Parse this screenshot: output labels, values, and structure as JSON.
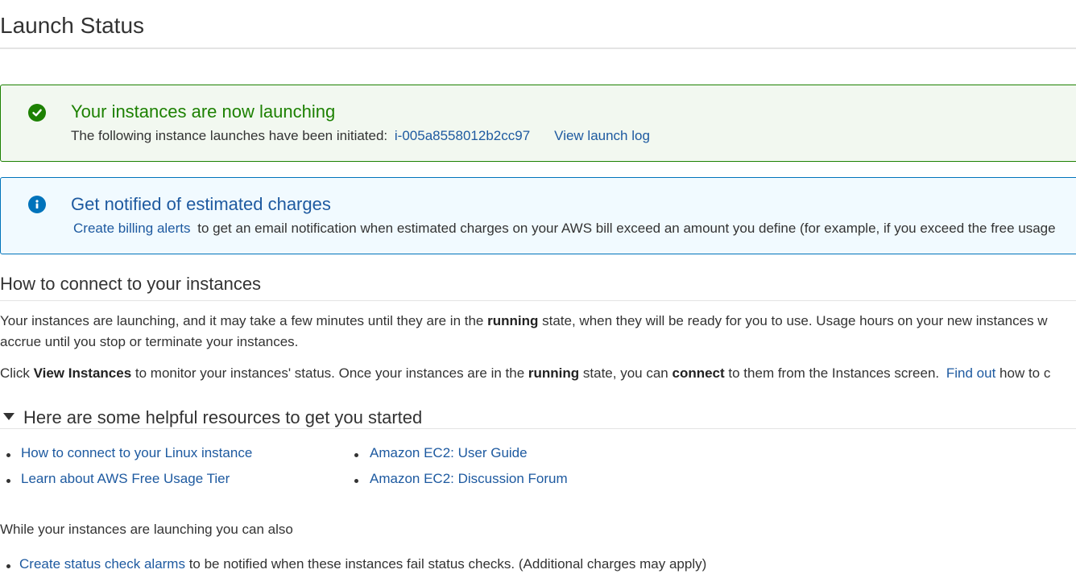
{
  "page": {
    "title": "Launch Status"
  },
  "success_alert": {
    "heading": "Your instances are now launching",
    "body_text": "The following instance launches have been initiated:",
    "instance_id": "i-005a8558012b2cc97",
    "view_log_label": "View launch log",
    "icon": "check-circle-icon",
    "color": "#1d8102"
  },
  "info_alert": {
    "heading": "Get notified of estimated charges",
    "link_label": "Create billing alerts",
    "body_text": "to get an email notification when estimated charges on your AWS bill exceed an amount you define (for example, if you exceed the free usage",
    "icon": "info-circle-icon",
    "color": "#0073bb"
  },
  "connect_section": {
    "heading": "How to connect to your instances",
    "para1_a": "Your instances are launching, and it may take a few minutes until they are in the",
    "para1_bold": "running",
    "para1_b": "state, when they will be ready for you to use. Usage hours on your new instances w",
    "para1_line2": "accrue until you stop or terminate your instances.",
    "para2_a": "Click",
    "para2_bold1": "View Instances",
    "para2_b": "to monitor your instances' status. Once your instances are in the",
    "para2_bold2": "running",
    "para2_c": "state, you can",
    "para2_bold3": "connect",
    "para2_d": "to them from the Instances screen.",
    "find_out_label": "Find out",
    "para2_e": "how to c"
  },
  "resources_section": {
    "heading": "Here are some helpful resources to get you started",
    "left_links": [
      "How to connect to your Linux instance",
      "Learn about AWS Free Usage Tier"
    ],
    "right_links": [
      "Amazon EC2: User Guide",
      "Amazon EC2: Discussion Forum"
    ]
  },
  "also_section": {
    "heading": "While your instances are launching you can also",
    "item_link": "Create status check alarms",
    "item_text": "to be notified when these instances fail status checks. (Additional charges may apply)"
  }
}
